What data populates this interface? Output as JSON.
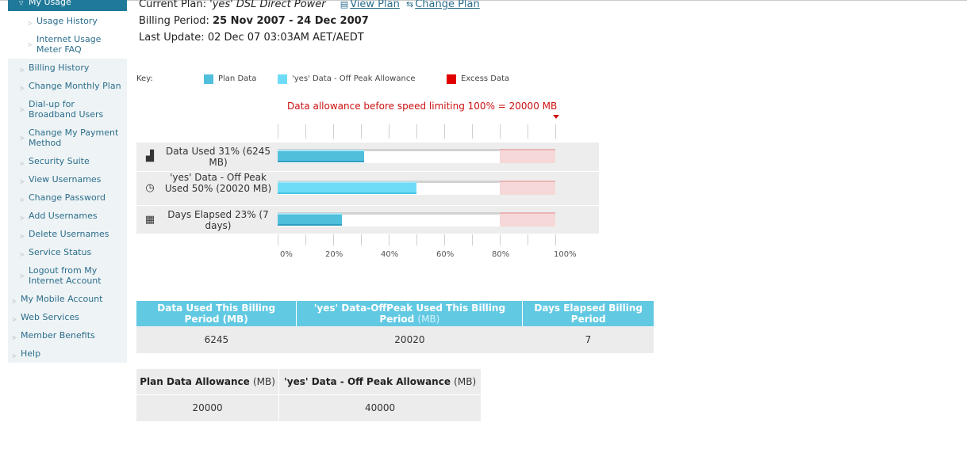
{
  "sidebar": {
    "header": "My Usage",
    "sub_items": [
      {
        "label": "Usage History"
      },
      {
        "label": "Internet Usage Meter FAQ"
      }
    ],
    "items": [
      {
        "label": "Billing History"
      },
      {
        "label": "Change Monthly Plan"
      },
      {
        "label": "Dial-up for Broadband Users"
      },
      {
        "label": "Change My Payment Method"
      },
      {
        "label": "Security Suite"
      },
      {
        "label": "View Usernames"
      },
      {
        "label": "Change Password"
      },
      {
        "label": "Add Usernames"
      },
      {
        "label": "Delete Usernames"
      },
      {
        "label": "Service Status"
      },
      {
        "label": "Logout from My Internet Account"
      }
    ],
    "top_items": [
      {
        "label": "My Mobile Account"
      },
      {
        "label": "Web Services"
      },
      {
        "label": "Member Benefits"
      },
      {
        "label": "Help"
      }
    ]
  },
  "plan": {
    "current_label": "Current Plan:",
    "current_value": "'yes' DSL Direct Power",
    "view_plan": "View Plan",
    "change_plan": "Change Plan",
    "billing_label": "Billing Period:",
    "billing_value": "25 Nov 2007 - 24 Dec 2007",
    "update_label": "Last Update:",
    "update_value": "02 Dec 07 03:03AM AET/AEDT"
  },
  "key": {
    "label": "Key:",
    "items": [
      {
        "label": "Plan Data",
        "color": "#4fbfdc"
      },
      {
        "label": "'yes' Data - Off Peak Allowance",
        "color": "#6fdcf7"
      },
      {
        "label": "Excess Data",
        "color": "#e00000"
      }
    ]
  },
  "allowance_note": "Data allowance before speed limiting 100% = 20000 MB",
  "chart_data": {
    "type": "bar",
    "orientation": "horizontal",
    "xlim": [
      0,
      100
    ],
    "unit": "%",
    "ticks": [
      "0%",
      "20%",
      "40%",
      "60%",
      "80%",
      "100%"
    ],
    "categories": [
      "Data Used 31% (6245 MB)",
      "'yes' Data - Off Peak Used 50% (20020 MB)",
      "Days Elapsed 23% (7 days)"
    ],
    "values": [
      31,
      50,
      23
    ],
    "colors": [
      "#4fbfdc",
      "#6fdcf7",
      "#4fbfdc"
    ],
    "icons": [
      "signal-bars-icon",
      "clock-icon",
      "calendar-icon"
    ],
    "excess_zone": [
      80,
      100
    ]
  },
  "usage_table": {
    "headers": [
      {
        "label": "Data Used This Billing Period",
        "unit": "(MB)"
      },
      {
        "label": "'yes' Data-OffPeak Used This Billing Period",
        "unit": "(MB)"
      },
      {
        "label": "Days Elapsed Billing Period",
        "unit": ""
      }
    ],
    "values": [
      "6245",
      "20020",
      "7"
    ]
  },
  "allowance_table": {
    "headers": [
      {
        "label": "Plan Data Allowance",
        "unit": "(MB)"
      },
      {
        "label": "'yes' Data - Off Peak Allowance",
        "unit": "(MB)"
      }
    ],
    "values": [
      "20000",
      "40000"
    ]
  }
}
